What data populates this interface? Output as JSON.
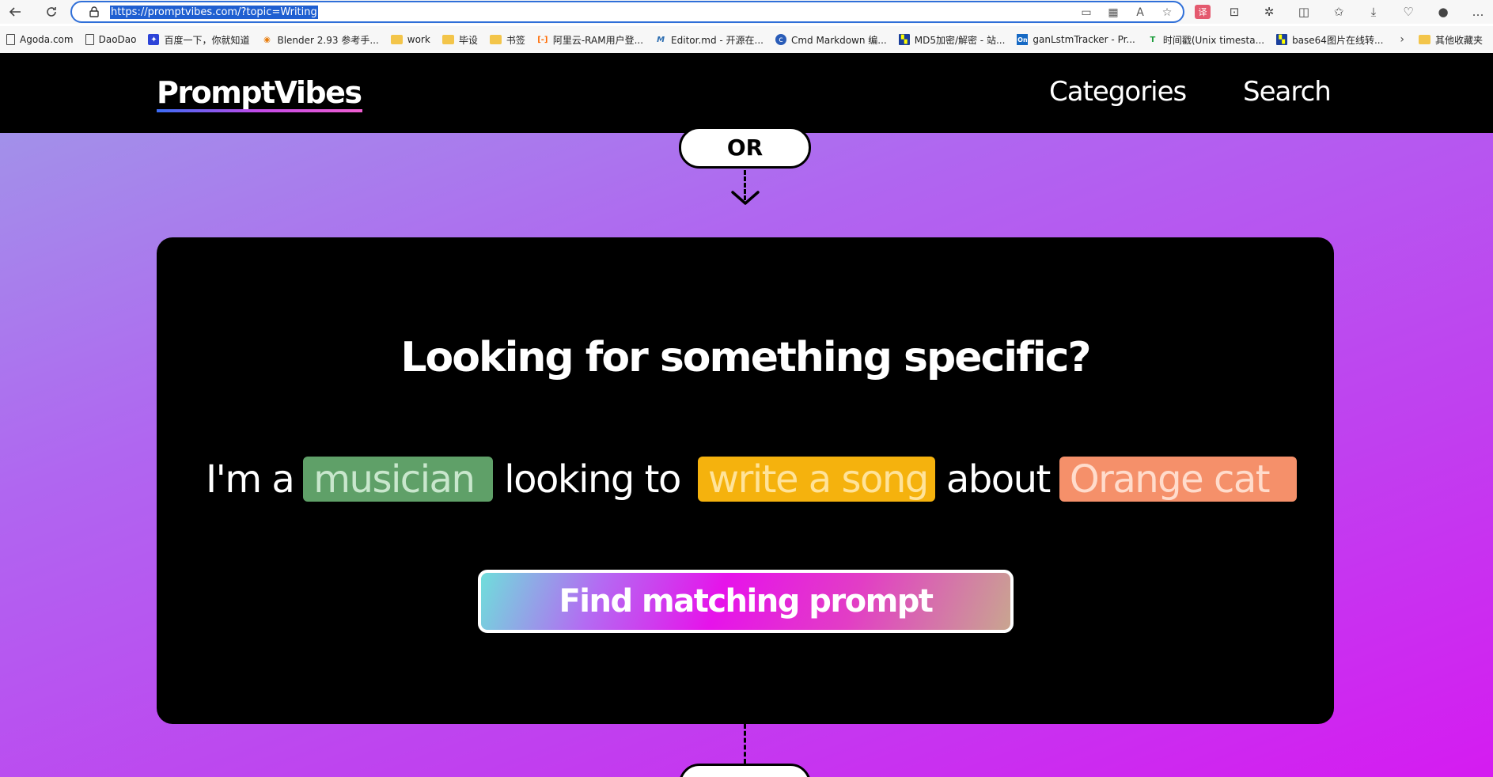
{
  "browser": {
    "url": "https://promptvibes.com/?topic=Writing",
    "bookmarks": [
      {
        "label": "Agoda.com",
        "icon": "page-icon"
      },
      {
        "label": "DaoDao",
        "icon": "page-icon"
      },
      {
        "label": "百度一下，你就知道",
        "icon": "baidu-icon"
      },
      {
        "label": "Blender 2.93 参考手...",
        "icon": "blender-icon"
      },
      {
        "label": "work",
        "icon": "folder-icon"
      },
      {
        "label": "毕设",
        "icon": "folder-icon"
      },
      {
        "label": "书签",
        "icon": "folder-icon"
      },
      {
        "label": "阿里云-RAM用户登...",
        "icon": "aliyun-icon"
      },
      {
        "label": "Editor.md - 开源在...",
        "icon": "editor-icon"
      },
      {
        "label": "Cmd Markdown 编...",
        "icon": "cmd-icon"
      },
      {
        "label": "MD5加密/解密 - 站...",
        "icon": "md5-icon"
      },
      {
        "label": "ganLstmTracker - Pr...",
        "icon": "on-icon"
      },
      {
        "label": "时间戳(Unix timesta...",
        "icon": "timestamp-icon"
      },
      {
        "label": "base64图片在线转...",
        "icon": "base64-icon"
      },
      {
        "label": "其他收藏夹",
        "icon": "folder-icon"
      }
    ]
  },
  "header": {
    "logo": "PromptVibes",
    "nav": {
      "categories": "Categories",
      "search": "Search"
    }
  },
  "flow": {
    "or_label": "OR"
  },
  "finder": {
    "title": "Looking for something specific?",
    "sentence": {
      "prefix": "I'm a",
      "role": "musician",
      "middle": "looking to",
      "task": "write a song",
      "connector": "about",
      "topic": "Orange cat"
    },
    "button": "Find matching prompt"
  },
  "colors": {
    "role_chip": "#5fa068",
    "task_chip": "#f5b20d",
    "topic_chip": "#f5906a"
  }
}
